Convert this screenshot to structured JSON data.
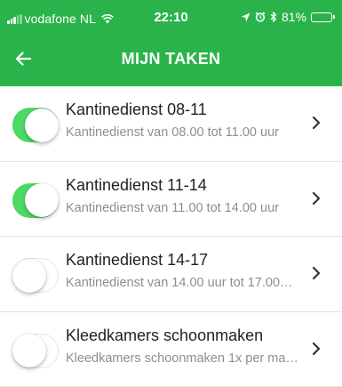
{
  "status_bar": {
    "carrier": "vodafone NL",
    "time": "22:10",
    "battery_percent": "81%",
    "battery_level": 0.81,
    "icons": [
      "signal-icon",
      "wifi-icon",
      "location-arrow-icon",
      "alarm-icon",
      "bluetooth-icon",
      "battery-icon"
    ]
  },
  "nav": {
    "title": "MIJN TAKEN",
    "back_icon": "arrow-left-icon"
  },
  "colors": {
    "header": "#2bb34b",
    "toggle_on": "#4cd964",
    "title_text": "#222222",
    "subtitle_text": "#8e8e8e"
  },
  "tasks": [
    {
      "title": "Kantinedienst 08-11",
      "subtitle": "Kantinedienst van 08.00 tot 11.00 uur",
      "enabled": true
    },
    {
      "title": "Kantinedienst 11-14",
      "subtitle": "Kantinedienst van 11.00 tot 14.00 uur",
      "enabled": true
    },
    {
      "title": "Kantinedienst 14-17",
      "subtitle": "Kantinedienst van 14.00 uur tot 17.00…",
      "enabled": false
    },
    {
      "title": "Kleedkamers schoonmaken",
      "subtitle": "Kleedkamers schoonmaken 1x per ma…",
      "enabled": false
    }
  ]
}
